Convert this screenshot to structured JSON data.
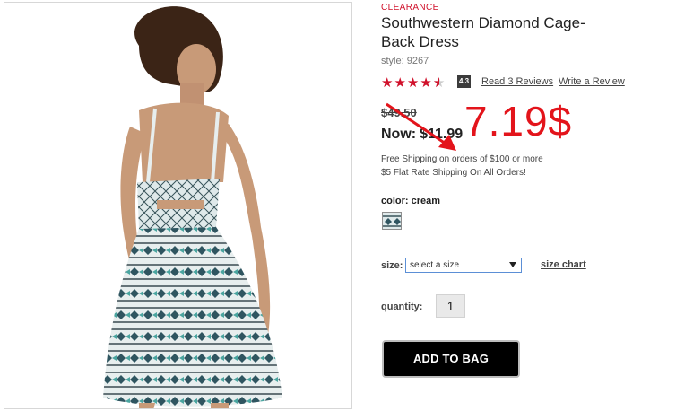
{
  "product": {
    "badge": "CLEARANCE",
    "title": "Southwestern Diamond Cage-Back Dress",
    "style_label": "style:",
    "style_number": "9267",
    "image_alt": "Woman wearing sleeveless patterned dress, back view"
  },
  "rating": {
    "value": 4.3,
    "value_text": "4.3",
    "stars_full": 4,
    "read_reviews": "Read 3 Reviews",
    "write_review": "Write a Review"
  },
  "pricing": {
    "old_price": "$49.50",
    "now_label": "Now:",
    "now_price": "$11.99",
    "annotation": "7.19$"
  },
  "shipping": {
    "line1": "Free Shipping on orders of $100 or more",
    "line2": "$5 Flat Rate Shipping On All Orders!"
  },
  "color": {
    "label": "color:",
    "value": "cream"
  },
  "size": {
    "label": "size:",
    "selected": "select a size",
    "chart_link": "size chart"
  },
  "quantity": {
    "label": "quantity:",
    "value": "1"
  },
  "actions": {
    "add_to_bag": "ADD TO BAG"
  },
  "colors": {
    "accent_red": "#d0112b",
    "annotation_red": "#e3141b",
    "button_black": "#000000"
  }
}
